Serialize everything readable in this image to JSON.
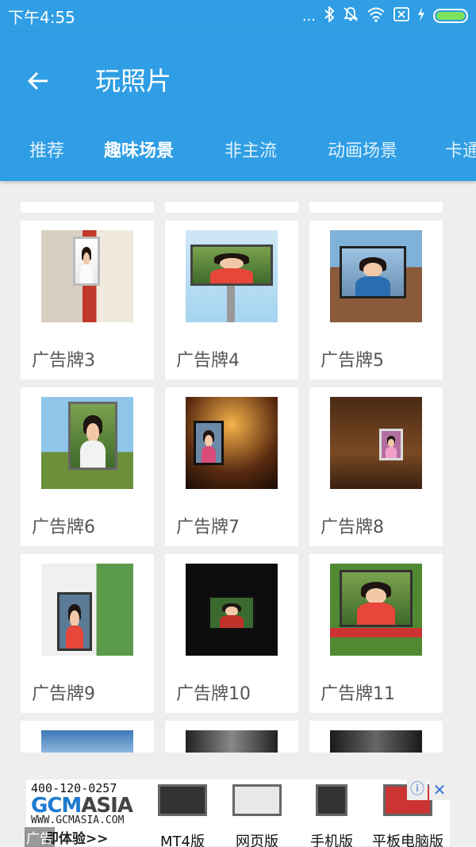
{
  "status_bar": {
    "time": "下午4:55",
    "dots": "...",
    "colors": {
      "bg": "#2f9ee4",
      "battery": "#7ee25d"
    }
  },
  "app_bar": {
    "title": "玩照片",
    "back_icon": "arrow-left-icon"
  },
  "tabs": [
    "推荐",
    "趣味场景",
    "非主流",
    "动画场景",
    "卡通相框"
  ],
  "active_tab": "趣味场景",
  "grid": {
    "items": [
      {
        "label": "广告牌3"
      },
      {
        "label": "广告牌4"
      },
      {
        "label": "广告牌5"
      },
      {
        "label": "广告牌6"
      },
      {
        "label": "广告牌7"
      },
      {
        "label": "广告牌8"
      },
      {
        "label": "广告牌9"
      },
      {
        "label": "广告牌10"
      },
      {
        "label": "广告牌11"
      }
    ]
  },
  "ad": {
    "phone": "400-120-0257",
    "brand_a": "GCM",
    "brand_b": "ASIA",
    "url": "WWW.GCMASIA.COM",
    "experience": "即体验>>",
    "tag": "广告",
    "items": [
      "MT4版",
      "网页版",
      "手机版",
      "平板电脑版"
    ],
    "close": "✕",
    "info": "ⓘ"
  }
}
